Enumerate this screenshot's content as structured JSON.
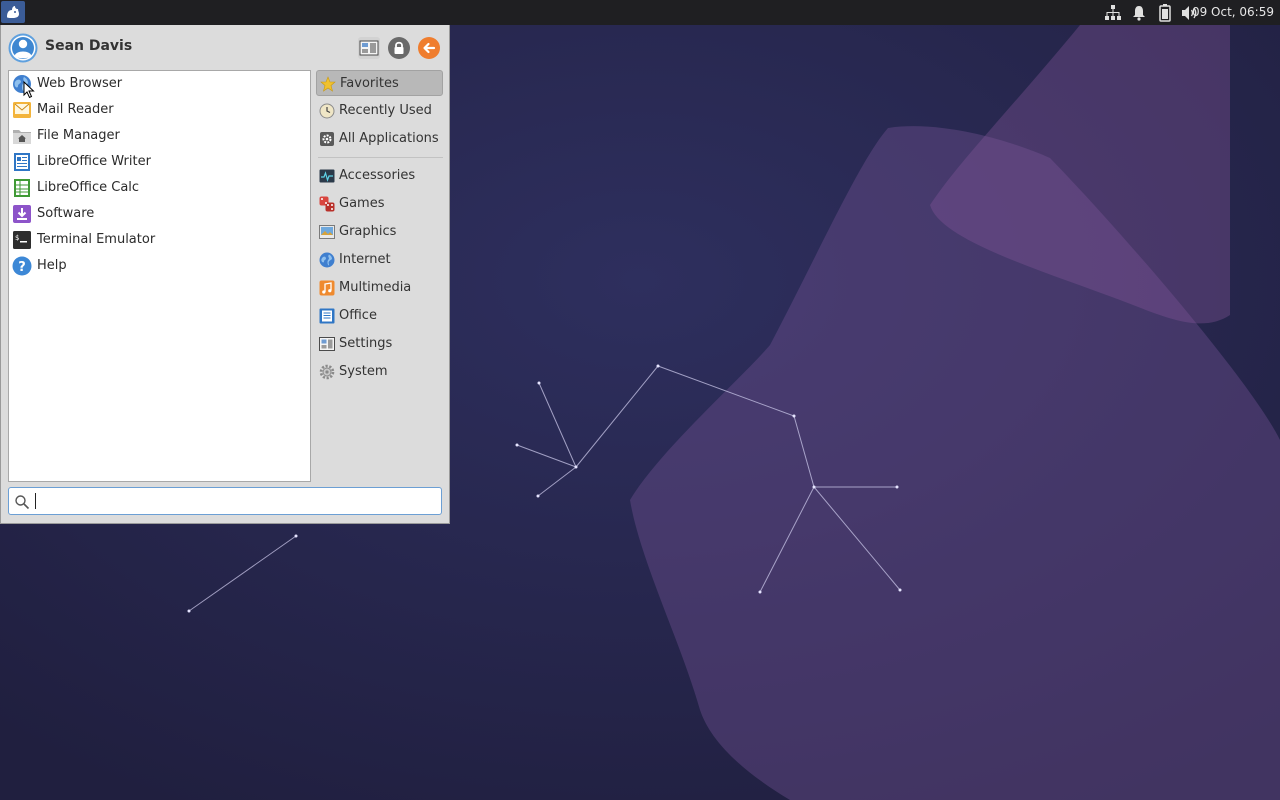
{
  "panel": {
    "clock": "09 Oct, 06:59",
    "icons": [
      "whisker-menu-icon",
      "network-icon",
      "notification-bell-icon",
      "battery-icon",
      "volume-icon"
    ]
  },
  "menu": {
    "user_name": "Sean Davis",
    "header_buttons": [
      "settings-manager-icon",
      "lock-screen-icon",
      "log-out-icon"
    ],
    "favorites": [
      {
        "label": "Web Browser",
        "icon": "web-browser-icon"
      },
      {
        "label": "Mail Reader",
        "icon": "mail-reader-icon"
      },
      {
        "label": "File Manager",
        "icon": "file-manager-icon"
      },
      {
        "label": "LibreOffice Writer",
        "icon": "libreoffice-writer-icon"
      },
      {
        "label": "LibreOffice Calc",
        "icon": "libreoffice-calc-icon"
      },
      {
        "label": "Software",
        "icon": "software-icon"
      },
      {
        "label": "Terminal Emulator",
        "icon": "terminal-icon"
      },
      {
        "label": "Help",
        "icon": "help-icon"
      }
    ],
    "categories_top": [
      {
        "label": "Favorites",
        "icon": "star-icon",
        "selected": true
      },
      {
        "label": "Recently Used",
        "icon": "clock-icon"
      },
      {
        "label": "All Applications",
        "icon": "gear-icon"
      }
    ],
    "categories": [
      {
        "label": "Accessories",
        "icon": "accessories-icon"
      },
      {
        "label": "Games",
        "icon": "games-icon"
      },
      {
        "label": "Graphics",
        "icon": "graphics-icon"
      },
      {
        "label": "Internet",
        "icon": "internet-icon"
      },
      {
        "label": "Multimedia",
        "icon": "multimedia-icon"
      },
      {
        "label": "Office",
        "icon": "office-icon"
      },
      {
        "label": "Settings",
        "icon": "settings-icon"
      },
      {
        "label": "System",
        "icon": "system-icon"
      }
    ],
    "search": {
      "value": "",
      "placeholder": ""
    }
  },
  "colors": {
    "desktop": "#27274a",
    "panel": "#1f1f22",
    "menu_bg": "#dcdcdc",
    "selection": "#b8b8b8",
    "accent": "#6c9fd4"
  }
}
